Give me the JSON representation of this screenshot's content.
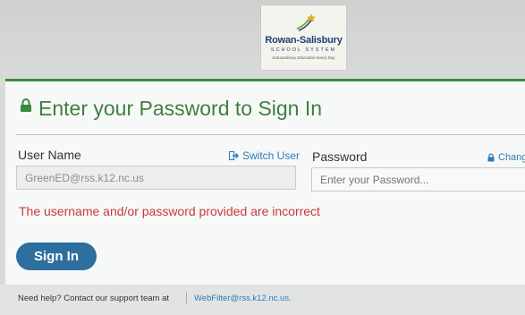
{
  "logo": {
    "name": "Rowan-Salisbury",
    "sub": "SCHOOL SYSTEM",
    "tagline": "Extraordinary Education Every Day"
  },
  "signin": {
    "title": "Enter your Password to Sign In",
    "username_label": "User Name",
    "switch_user_label": "Switch User",
    "password_label": "Password",
    "change_label": "Chang",
    "username_value": "GreenED@rss.k12.nc.us",
    "password_placeholder": "Enter your Password...",
    "error": "The username and/or password provided are incorrect",
    "signin_button": "Sign In"
  },
  "footer": {
    "help_text": "Need help? Contact our support team at",
    "support_link": "WebFilter@rss.k12.nc.us."
  },
  "colors": {
    "accent_green": "#3a8b3b",
    "link_blue": "#2b7bb8",
    "error_red": "#c83a3a",
    "button_blue": "#2d6f9e"
  },
  "icons": [
    "lock-icon",
    "switch-user-icon",
    "lock-small-icon",
    "star-swoosh-logo-icon"
  ]
}
